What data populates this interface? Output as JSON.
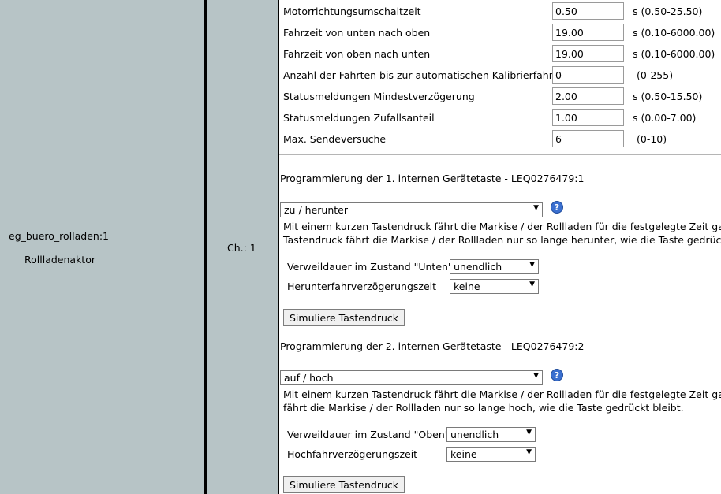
{
  "device": {
    "name": "eg_buero_rolladen:1",
    "type": "Rollladenaktor"
  },
  "channel": {
    "label": "Ch.: 1"
  },
  "params": [
    {
      "label": "Motorrichtungsumschaltzeit",
      "value": "0.50",
      "range": "s (0.50-25.50)"
    },
    {
      "label": "Fahrzeit von unten nach oben",
      "value": "19.00",
      "range": "s (0.10-6000.00)"
    },
    {
      "label": "Fahrzeit von oben nach unten",
      "value": "19.00",
      "range": "s (0.10-6000.00)"
    },
    {
      "label": "Anzahl der Fahrten bis zur automatischen Kalibrierfahrt",
      "value": "0",
      "range": "(0-255)"
    },
    {
      "label": "Statusmeldungen Mindestverzögerung",
      "value": "2.00",
      "range": "s (0.50-15.50)"
    },
    {
      "label": "Statusmeldungen Zufallsanteil",
      "value": "1.00",
      "range": "s (0.00-7.00)"
    },
    {
      "label": "Max. Sendeversuche",
      "value": "6",
      "range": "(0-10)"
    }
  ],
  "key1": {
    "header": "Programmierung der 1. internen Gerätetaste - LEQ0276479:1",
    "mode": "zu / herunter",
    "help_icon": "question-mark-icon",
    "desc_line1": "Mit einem kurzen Tastendruck fährt die Markise / der Rollladen für die festgelegte Zeit ganz",
    "desc_line2": "Tastendruck fährt die Markise / der Rollladen nur so lange herunter, wie die Taste gedrückt b",
    "dwell_label": "Verweildauer im Zustand \"Unten\"",
    "dwell_value": "unendlich",
    "delay_label": "Herunterfahrverzögerungszeit",
    "delay_value": "keine",
    "simulate": "Simuliere Tastendruck"
  },
  "key2": {
    "header": "Programmierung der 2. internen Gerätetaste - LEQ0276479:2",
    "mode": "auf / hoch",
    "help_icon": "question-mark-icon",
    "desc_line1": "Mit einem kurzen Tastendruck fährt die Markise / der Rollladen für die festgelegte Zeit ganz",
    "desc_line2": "fährt die Markise / der Rollladen nur so lange hoch, wie die Taste gedrückt bleibt.",
    "dwell_label": "Verweildauer im Zustand \"Oben\"",
    "dwell_value": "unendlich",
    "delay_label": "Hochfahrverzögerungszeit",
    "delay_value": "keine",
    "simulate": "Simuliere Tastendruck"
  },
  "colors": {
    "panel_bg": "#b7c4c6",
    "help_blue": "#3a6fcf"
  }
}
